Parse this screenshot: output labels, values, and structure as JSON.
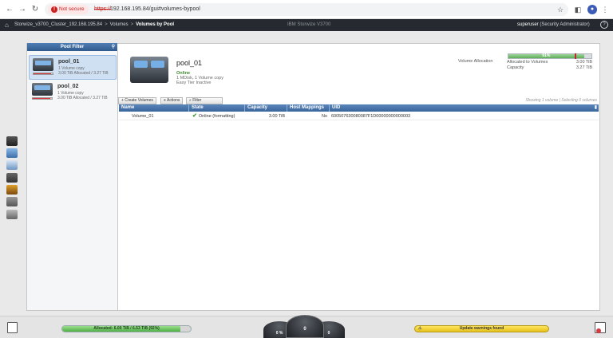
{
  "browser": {
    "not_secure": "Not secure",
    "url_scheme": "https://",
    "url_rest": "192.168.195.84/gui#volumes-bypool"
  },
  "header": {
    "breadcrumbs": [
      "Storwize_v3700_Cluster_192.168.195.84",
      "Volumes",
      "Volumes by Pool"
    ],
    "product": "IBM Storwize V3700",
    "user": "superuser",
    "role": "(Security Administrator)"
  },
  "pool_filter": {
    "title": "Pool Filter",
    "pools": [
      {
        "name": "pool_01",
        "copies": "1 Volume copy",
        "allocation": "3.00 TiB Allocated / 3.27 TiB",
        "alloc_fraction": 0.92
      },
      {
        "name": "pool_02",
        "copies": "1 Volume copy",
        "allocation": "3.00 TiB Allocated / 3.27 TiB",
        "alloc_fraction": 0.92
      }
    ]
  },
  "details": {
    "name": "pool_01",
    "status": "Online",
    "line1": "1 MDisk, 1 Volume copy",
    "line2": "Easy Tier Inactive"
  },
  "volume_allocation": {
    "label": "Volume Allocation",
    "percent_text": "91%",
    "fraction": 0.91,
    "rows": [
      {
        "key": "Allocated to Volumes",
        "value": "3.00 TiB"
      },
      {
        "key": "Capacity",
        "value": "3.27 TiB"
      }
    ]
  },
  "toolbar": {
    "create": "+ Create Volumes",
    "actions": "≡ Actions",
    "filter": "⌕ Filter",
    "showing": "Showing 1 volume | Selecting 0 volumes"
  },
  "table": {
    "columns": [
      "Name",
      "State",
      "Capacity",
      "Host Mappings",
      "UID"
    ],
    "rows": [
      {
        "name": "Volume_01",
        "state": "Online (formatting)",
        "capacity": "3.00 TiB",
        "host_mappings": "No",
        "uid": "600507630080087F1D00000000000003"
      }
    ]
  },
  "status_bar": {
    "allocated": "Allocated: 6.00 TiB / 6.53 TiB (92%)",
    "allocated_fraction": 0.92,
    "gauge_left": "0 %",
    "gauge_center": "0",
    "gauge_right": "0",
    "warnings": "Update warnings found"
  },
  "colors": {
    "accent": "#38659a",
    "header_bg": "#262a30",
    "ok_green": "#3c8d2f",
    "warn_yellow": "#e7c21c"
  }
}
